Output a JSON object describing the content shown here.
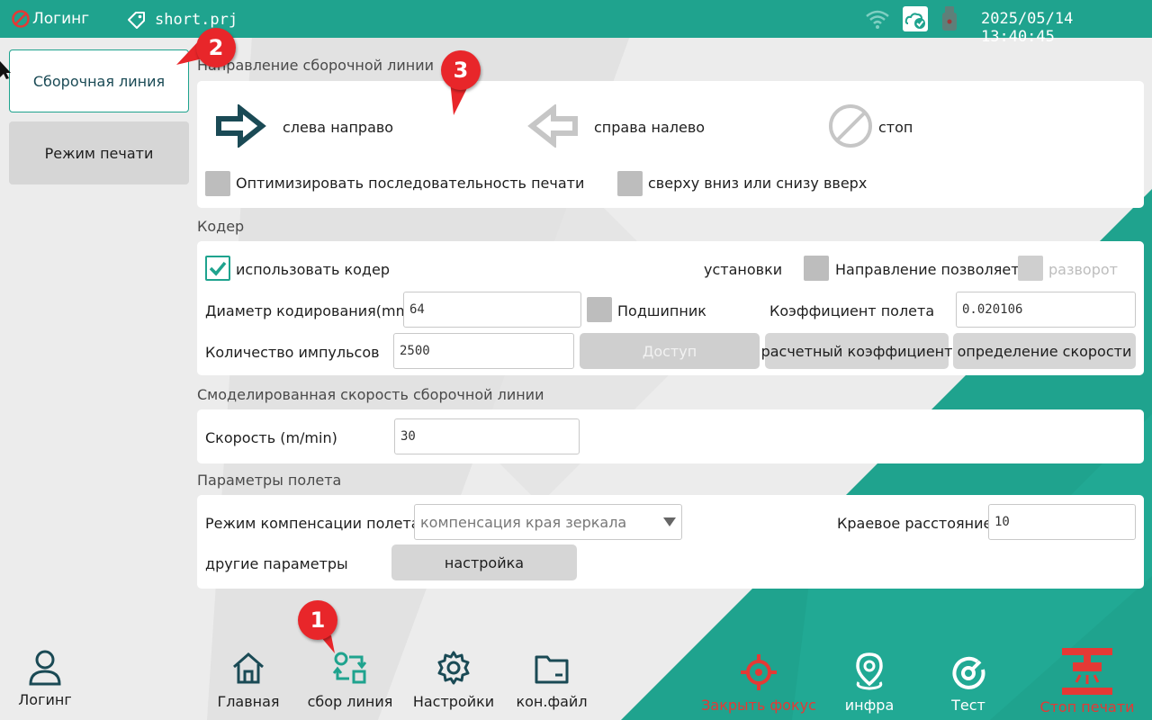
{
  "colors": {
    "accent": "#1fa38e",
    "accent_dark": "#1a4a55",
    "danger": "#e53935",
    "annotation": "#e8262a"
  },
  "topbar": {
    "login_label": "Логинг",
    "project_name": "short.prj",
    "datetime": "2025/05/14 13:40:45"
  },
  "sidebar": {
    "items": [
      {
        "label": "Сборочная линия",
        "active": true
      },
      {
        "label": "Режим печати",
        "active": false
      }
    ]
  },
  "direction": {
    "title": "Направление сборочной линии",
    "left_to_right": "слева направо",
    "right_to_left": "справа налево",
    "stop": "стоп",
    "optimize_label": "Оптимизировать последовательность печати",
    "top_bottom_label": "сверху вниз или снизу вверх"
  },
  "encoder": {
    "title": "Кодер",
    "use_encoder": "использовать кодер",
    "settings_label": "установки",
    "direction_allows": "Направление позволяет",
    "reverse": "разворот",
    "diameter_label": "Диаметр кодирования(mm)",
    "diameter_value": "64",
    "bearing": "Подшипник",
    "flight_coef_label": "Коэффициент полета",
    "flight_coef_value": "0.020106",
    "pulses_label": "Количество импульсов",
    "pulses_value": "2500",
    "access_button": "Доступ",
    "calc_coef_button": "расчетный коэффициент",
    "speed_detect_button": "определение скорости"
  },
  "simulated": {
    "title": "Смоделированная скорость сборочной линии",
    "speed_label": "Скорость (m/min)",
    "speed_value": "30"
  },
  "flight": {
    "title": "Параметры полета",
    "comp_mode_label": "Режим компенсации полета",
    "comp_mode_value": "компенсация края зеркала",
    "edge_distance_label": "Краевое расстояние",
    "edge_distance_value": "10",
    "other_params_label": "другие параметры",
    "setup_button": "настройка"
  },
  "bottombar": {
    "login": "Логинг",
    "home": "Главная",
    "line": "сбор линия",
    "settings": "Настройки",
    "config_file": "кон.файл",
    "close_focus": "Закрыть фокус",
    "info": "инфра",
    "test": "Тест",
    "stop_print": "Стоп печати"
  },
  "annotations": {
    "badge1": "1",
    "badge2": "2",
    "badge3": "3"
  }
}
